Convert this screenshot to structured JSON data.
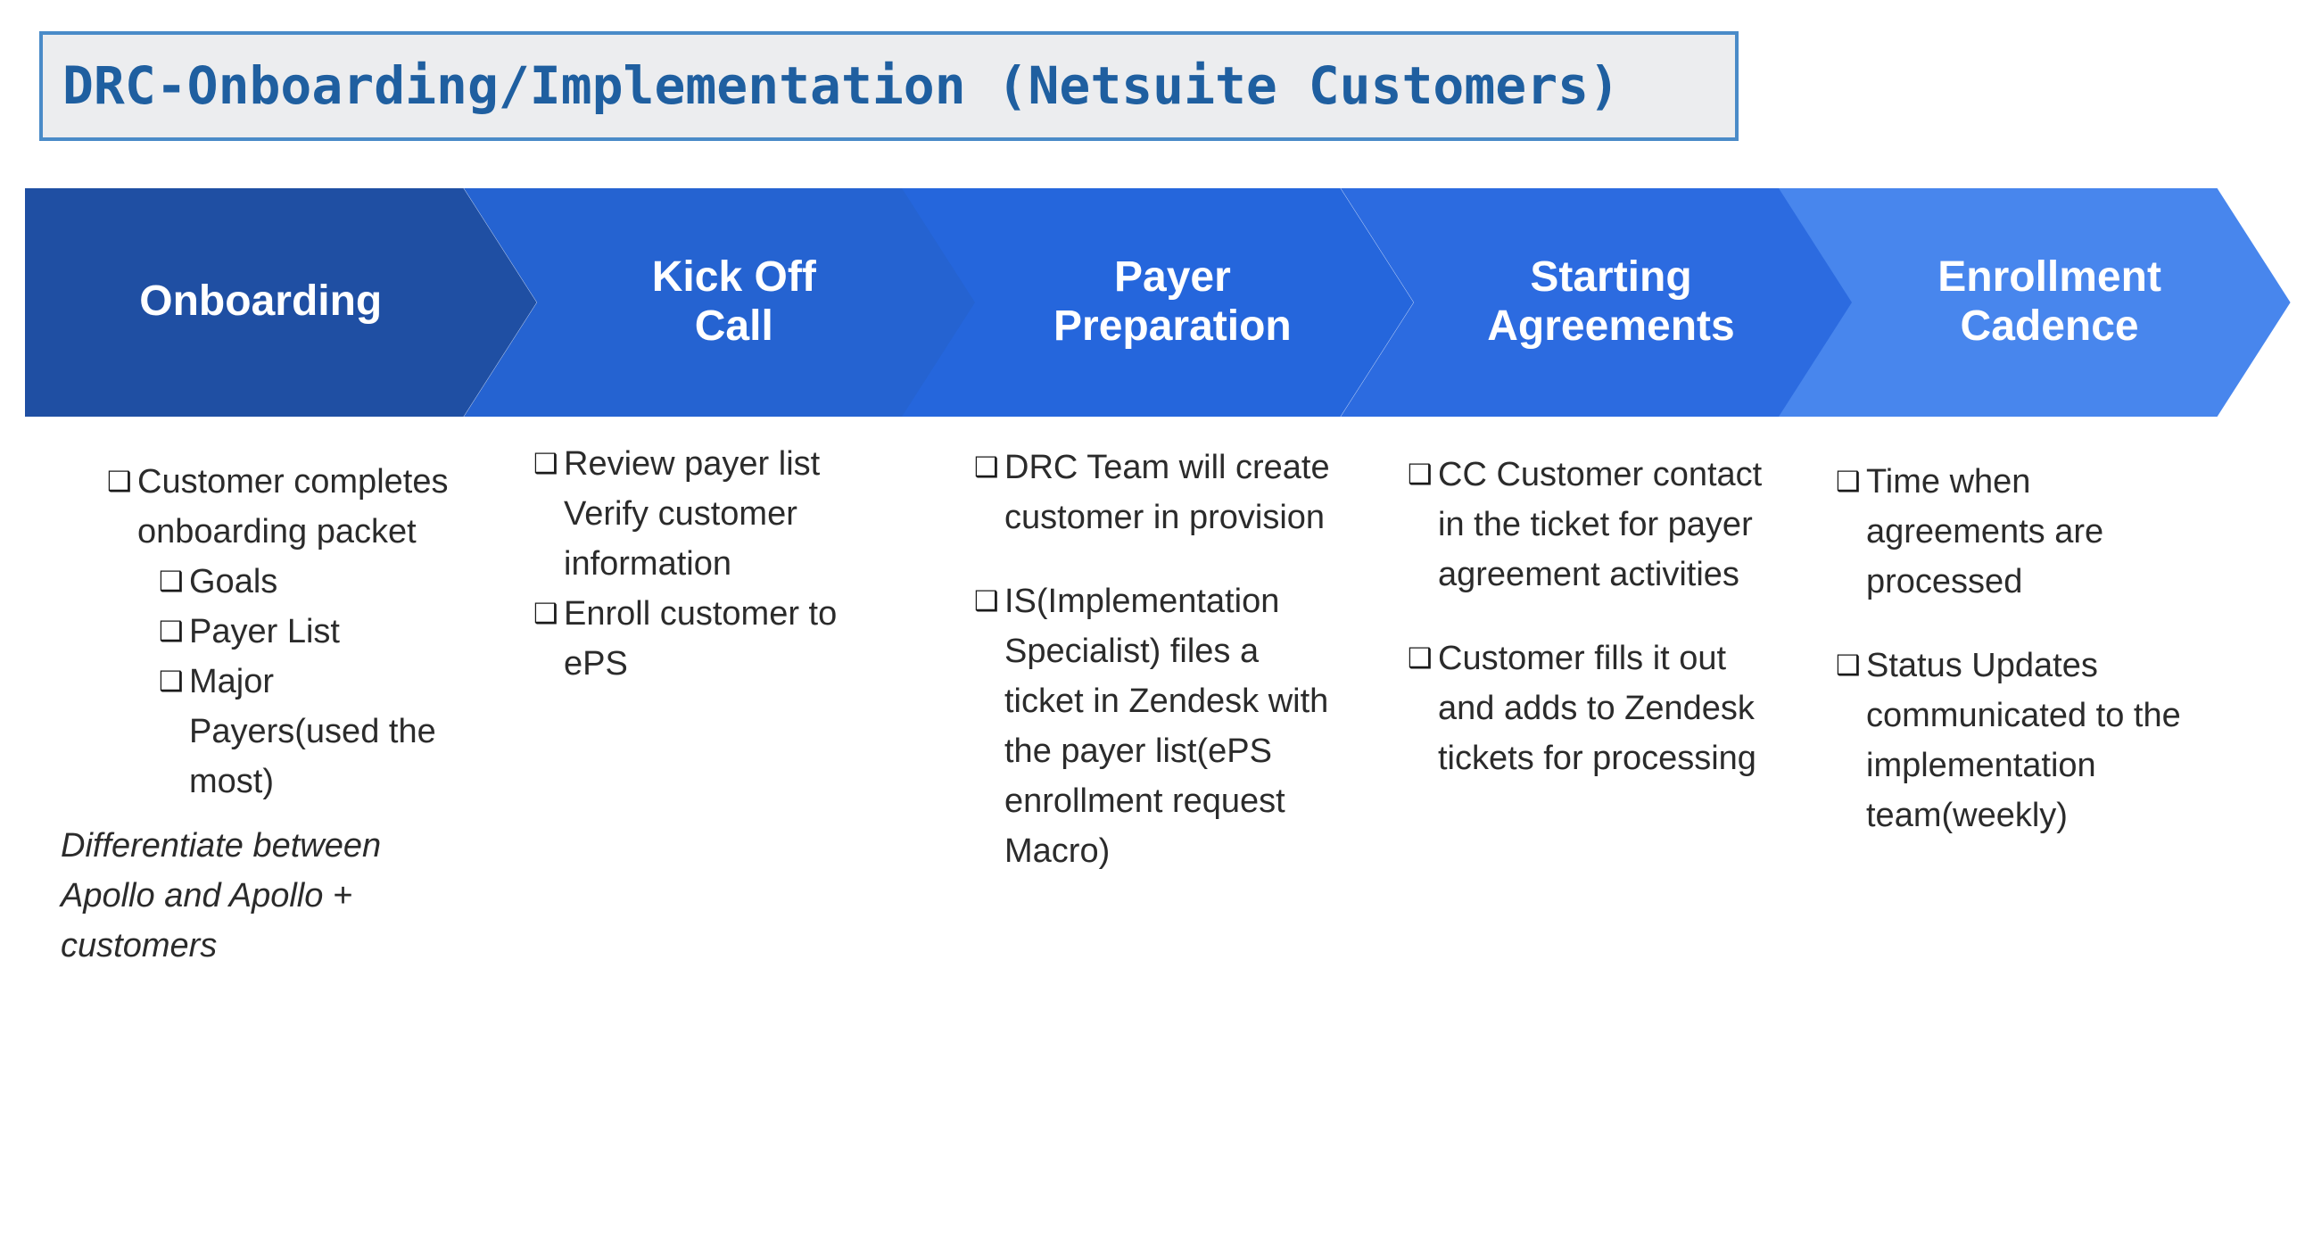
{
  "title": {
    "text": "DRC-Onboarding/Implementation (Netsuite Customers)",
    "text_color": "#1F5FA0",
    "border_color": "#4A8BC8",
    "background_color": "#ECEDEF"
  },
  "stages": [
    {
      "label": "Onboarding",
      "color": "#1F4FA3"
    },
    {
      "label": "Kick Off\nCall",
      "color": "#2563D1"
    },
    {
      "label": "Payer\nPreparation",
      "color": "#2566DC"
    },
    {
      "label": "Starting\nAgreements",
      "color": "#2C6BE0"
    },
    {
      "label": "Enrollment\nCadence",
      "color": "#4886ED"
    }
  ],
  "bullet_marker": "❑",
  "columns": [
    {
      "stage": "Onboarding",
      "items": [
        {
          "text": "Customer completes onboarding packet",
          "level": 0,
          "gap_after": false
        },
        {
          "text": "Goals",
          "level": 1,
          "gap_after": false
        },
        {
          "text": "Payer List",
          "level": 1,
          "gap_after": false
        },
        {
          "text": "Major Payers(used the most)",
          "level": 1,
          "gap_after": false
        }
      ],
      "note": "Differentiate between Apollo and Apollo + customers"
    },
    {
      "stage": "Kick Off Call",
      "items": [
        {
          "text": "Review payer list Verify customer information",
          "level": 0,
          "gap_after": false
        },
        {
          "text": "Enroll customer to ePS",
          "level": 0,
          "gap_after": false
        }
      ],
      "note": ""
    },
    {
      "stage": "Payer Preparation",
      "items": [
        {
          "text": "DRC Team will create customer in provision",
          "level": 0,
          "gap_after": true
        },
        {
          "text": "IS(Implementation Specialist) files a ticket in Zendesk with the payer list(ePS enrollment request Macro)",
          "level": 0,
          "gap_after": false
        }
      ],
      "note": ""
    },
    {
      "stage": "Starting Agreements",
      "items": [
        {
          "text": "CC Customer contact in the ticket for payer agreement activities",
          "level": 0,
          "gap_after": true
        },
        {
          "text": "Customer fills it out and adds to Zendesk tickets for processing",
          "level": 0,
          "gap_after": false
        }
      ],
      "note": ""
    },
    {
      "stage": "Enrollment Cadence",
      "items": [
        {
          "text": "Time when agreements are processed",
          "level": 0,
          "gap_after": true
        },
        {
          "text": "Status Updates communicated to the implementation team(weekly)",
          "level": 0,
          "gap_after": false
        }
      ],
      "note": ""
    }
  ]
}
